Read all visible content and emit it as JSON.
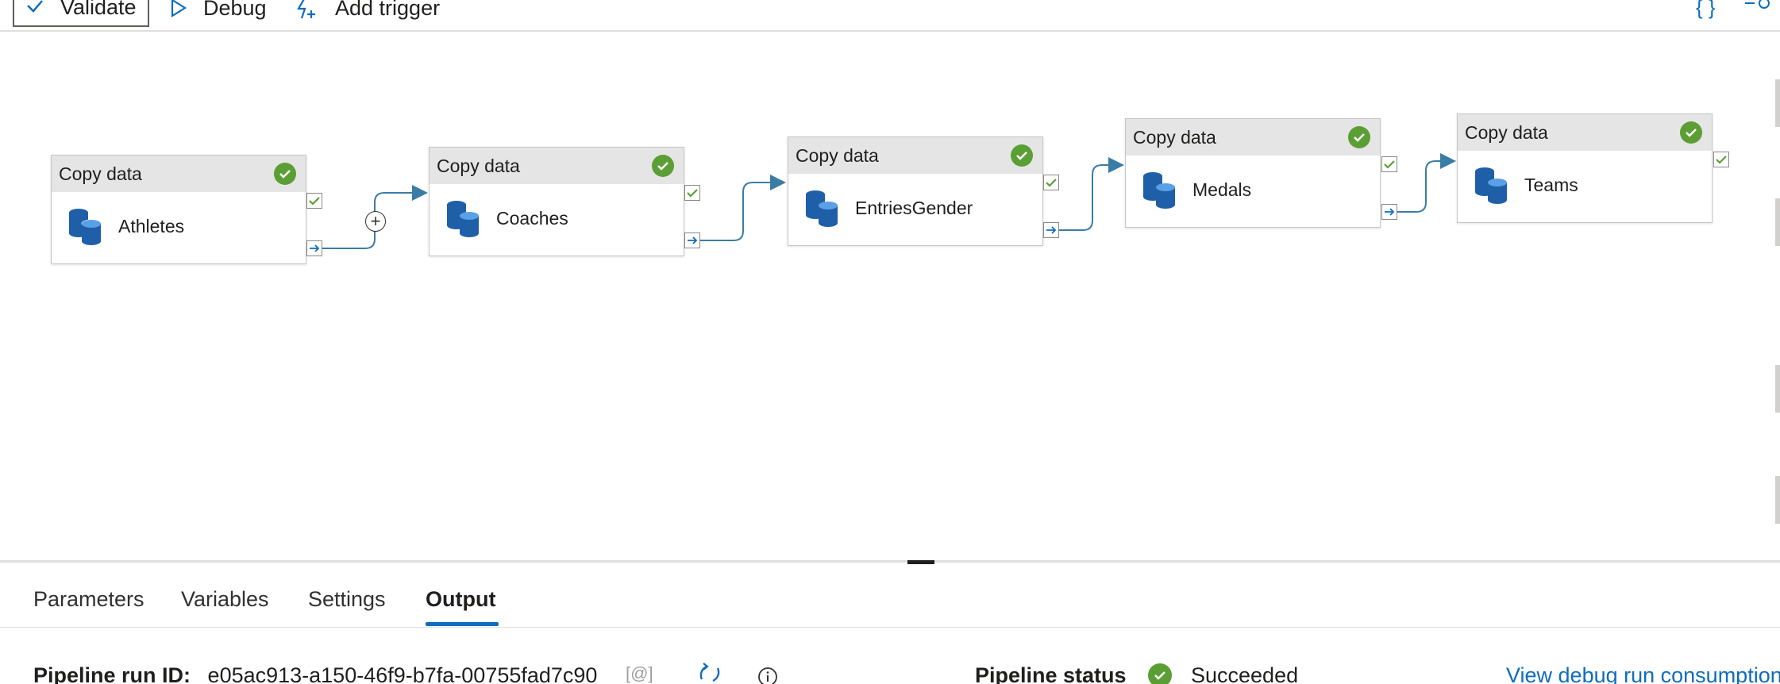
{
  "toolbar": {
    "validate_label": "Validate",
    "debug_label": "Debug",
    "add_trigger_label": "Add trigger"
  },
  "activities": [
    {
      "type": "Copy data",
      "name": "Athletes",
      "status": "succeeded"
    },
    {
      "type": "Copy data",
      "name": "Coaches",
      "status": "succeeded"
    },
    {
      "type": "Copy data",
      "name": "EntriesGender",
      "status": "succeeded"
    },
    {
      "type": "Copy data",
      "name": "Medals",
      "status": "succeeded"
    },
    {
      "type": "Copy data",
      "name": "Teams",
      "status": "succeeded"
    }
  ],
  "tabs": [
    {
      "label": "Parameters",
      "active": false
    },
    {
      "label": "Variables",
      "active": false
    },
    {
      "label": "Settings",
      "active": false
    },
    {
      "label": "Output",
      "active": true
    }
  ],
  "output": {
    "run_id_label": "Pipeline run ID:",
    "run_id_value": "e05ac913-a150-46f9-b7fa-00755fad7c90",
    "status_label": "Pipeline status",
    "status_value": "Succeeded",
    "consumption_link": "View debug run consumption"
  },
  "colors": {
    "accent": "#0f6cbd",
    "success": "#5b9e34",
    "connector": "#3a7ca5",
    "db_icon": "#1f5fa8"
  }
}
